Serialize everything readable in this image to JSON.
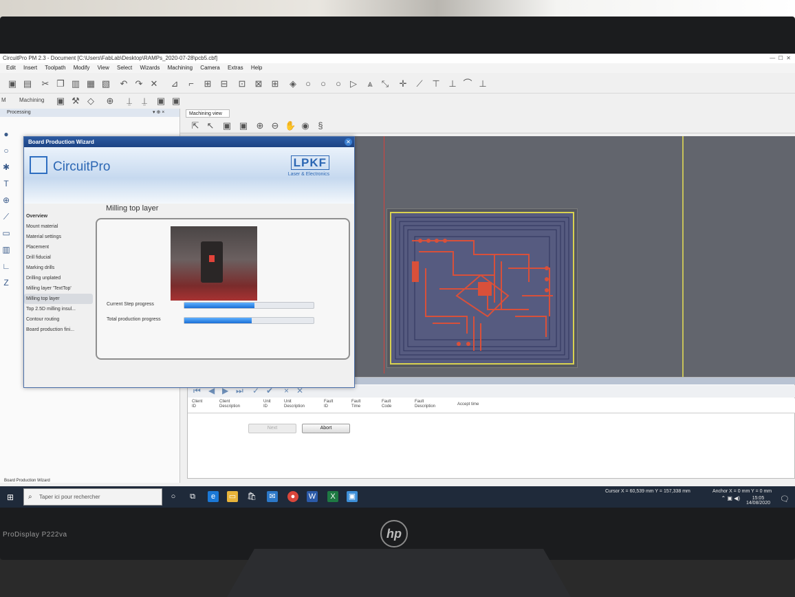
{
  "monitor": {
    "model": "ProDisplay P222va",
    "brand": "hp"
  },
  "app": {
    "title": "CircuitPro PM 2.3 - Document [C:\\Users\\FabLab\\Desktop\\RAMPs_2020-07-28\\pcb5.cbf]",
    "menu": [
      "Edit",
      "Insert",
      "Toolpath",
      "Modify",
      "View",
      "Select",
      "Wizards",
      "Machining",
      "Camera",
      "Extras",
      "Help"
    ],
    "toolbar2_label": "Machining",
    "toolbar2_prefix": "M"
  },
  "processing_panel": {
    "title": "Processing",
    "pin": "▾ ⊕ ×"
  },
  "machining_view": {
    "tab": "Machining view"
  },
  "wizard": {
    "title": "Board Production Wizard",
    "brand": "CircuitPro",
    "logo_word": "LPKF",
    "logo_sub": "Laser & Electronics",
    "step_title": "Milling top layer",
    "nav": [
      {
        "label": "Overview",
        "state": "bold"
      },
      {
        "label": "Mount material",
        "state": ""
      },
      {
        "label": "Material settings",
        "state": ""
      },
      {
        "label": "Placement",
        "state": ""
      },
      {
        "label": "Drill fiducial",
        "state": ""
      },
      {
        "label": "Marking drills",
        "state": ""
      },
      {
        "label": "Drilling unplated",
        "state": ""
      },
      {
        "label": "Milling layer 'TextTop'",
        "state": ""
      },
      {
        "label": "Milling top layer",
        "state": "active"
      },
      {
        "label": "Top 2.5D milling insul...",
        "state": ""
      },
      {
        "label": "Contour routing",
        "state": ""
      },
      {
        "label": "Board production fini...",
        "state": ""
      }
    ],
    "progress": [
      {
        "label": "Current Step progress",
        "value": 0.54
      },
      {
        "label": "Total production progress",
        "value": 0.52
      }
    ],
    "next_label": "Next",
    "abort_label": "Abort"
  },
  "job_grid": {
    "columns": [
      {
        "line1": "Client",
        "line2": "ID"
      },
      {
        "line1": "Client",
        "line2": "Description"
      },
      {
        "line1": "Unit",
        "line2": "ID"
      },
      {
        "line1": "Unit",
        "line2": "Description"
      },
      {
        "line1": "Fault",
        "line2": "ID"
      },
      {
        "line1": "Fault",
        "line2": "Time"
      },
      {
        "line1": "Fault",
        "line2": "Code"
      },
      {
        "line1": "Fault",
        "line2": "Description"
      },
      {
        "line1": "Accept time",
        "line2": ""
      }
    ]
  },
  "status": {
    "left": "Board Production Wizard",
    "cursor": "Cursor X = 60,539 mm   Y = 157,338 mm",
    "anchor": "Anchor X = 0 mm   Y = 0 mm"
  },
  "taskbar": {
    "search_placeholder": "Taper ici pour rechercher",
    "time": "15:05",
    "date": "14/08/2020"
  },
  "colors": {
    "canvas": "#62656d",
    "trace": "#d9503a",
    "board_fill": "#565b80",
    "outline": "#d9d24f",
    "accent": "#2c67b4"
  }
}
